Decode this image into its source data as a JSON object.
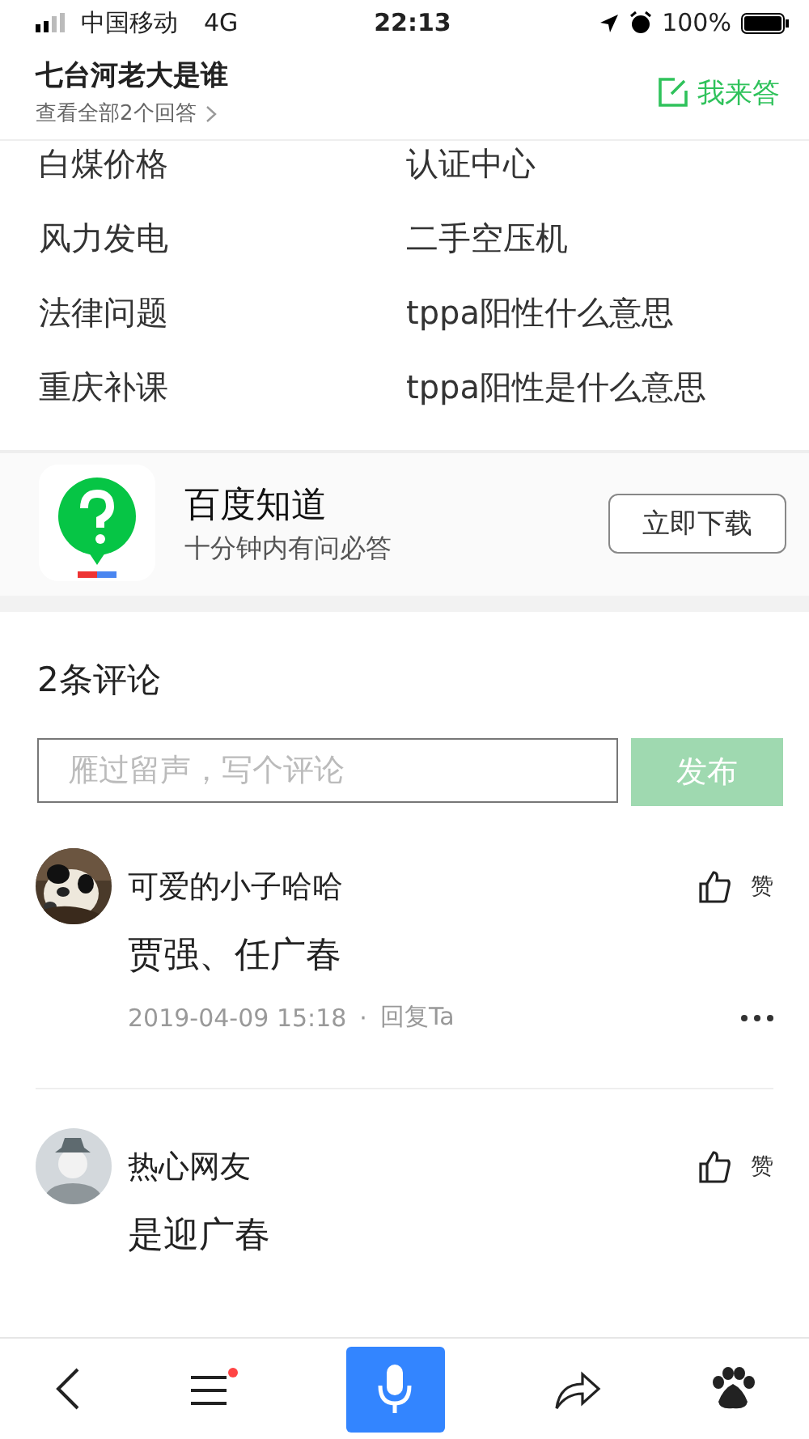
{
  "status_bar": {
    "carrier": "中国移动",
    "network": "4G",
    "time": "22:13",
    "battery": "100%"
  },
  "header": {
    "title": "七台河老大是谁",
    "subtitle": "查看全部2个回答",
    "answer_button": "我来答"
  },
  "related_links": [
    "白煤价格",
    "认证中心",
    "风力发电",
    "二手空压机",
    "法律问题",
    "tppa阳性什么意思",
    "重庆补课",
    "tppa阳性是什么意思"
  ],
  "app_promo": {
    "name": "百度知道",
    "slogan": "十分钟内有问必答",
    "download_button": "立即下载"
  },
  "comments_section": {
    "heading": "2条评论",
    "input": {
      "placeholder": "雁过留声，写个评论"
    },
    "publish_button": {
      "label": "发布",
      "disabled": true
    }
  },
  "comments": [
    {
      "user": "可爱的小子哈哈",
      "text": "贾强、任广春",
      "time": "2019-04-09 15:18",
      "separator": "·",
      "reply": "回复Ta",
      "like": "赞"
    },
    {
      "avatar": {
        "kind": "silhouette"
      },
      "user": "热心网友",
      "text": "是迎广春",
      "like": "赞"
    }
  ],
  "bottom_bar": {
    "menu_badge": true
  }
}
